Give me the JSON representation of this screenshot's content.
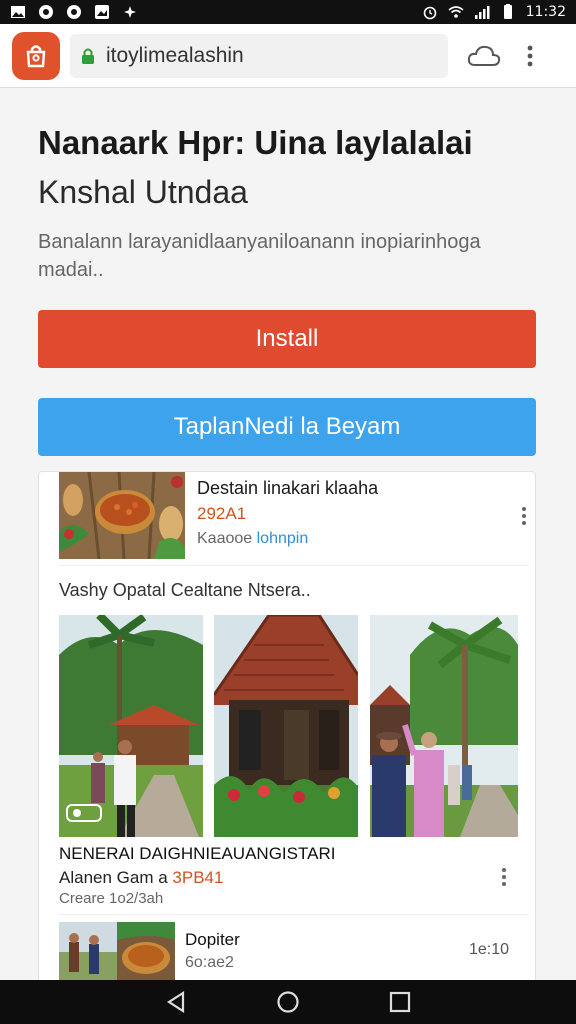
{
  "status_bar": {
    "left_icons": [
      "gallery-icon",
      "record-icon",
      "record-icon",
      "image-icon",
      "sparkle-icon"
    ],
    "time": "11:32"
  },
  "browser": {
    "url": "itoylimealashin",
    "app_icon": "store-bag-icon",
    "lock_icon": "lock-icon",
    "cloud_icon": "cloud-icon",
    "menu_icon": "more-vertical-icon"
  },
  "page": {
    "title": "Nanaark Hpr: Uina laylalalai",
    "subtitle": "Knshal Utndaa",
    "description": "Banalann larayanidlaanyaniloanann inopiarinhoga madai..",
    "install_label": "Install",
    "secondary_label": "TaplanNedi la Beyam"
  },
  "listing_1": {
    "title": "Destain linakari klaaha",
    "price": "292A1",
    "link_prefix": "Kaaooe ",
    "link_text": "lohnpin"
  },
  "gallery": {
    "label": "Vashy Opatal Cealtane Ntsera..",
    "photos": [
      "village-dancers-photo",
      "traditional-house-photo",
      "palm-tree-visitors-photo"
    ]
  },
  "listing_2": {
    "title": "NENERAI DAIGHNIEAUANGISTARI",
    "sub_prefix": "Alanen  Gam a ",
    "price": "3PB41",
    "meta": "Creare 1o2/3ah"
  },
  "listing_3": {
    "title": "Dopiter",
    "sub": "6o:ae2",
    "right": "1e:10"
  },
  "colors": {
    "install": "#e04a2e",
    "secondary": "#3da3ec",
    "price": "#d0541e",
    "app_icon": "#e0522c"
  },
  "nav": [
    "back-icon",
    "home-icon",
    "recents-icon"
  ]
}
